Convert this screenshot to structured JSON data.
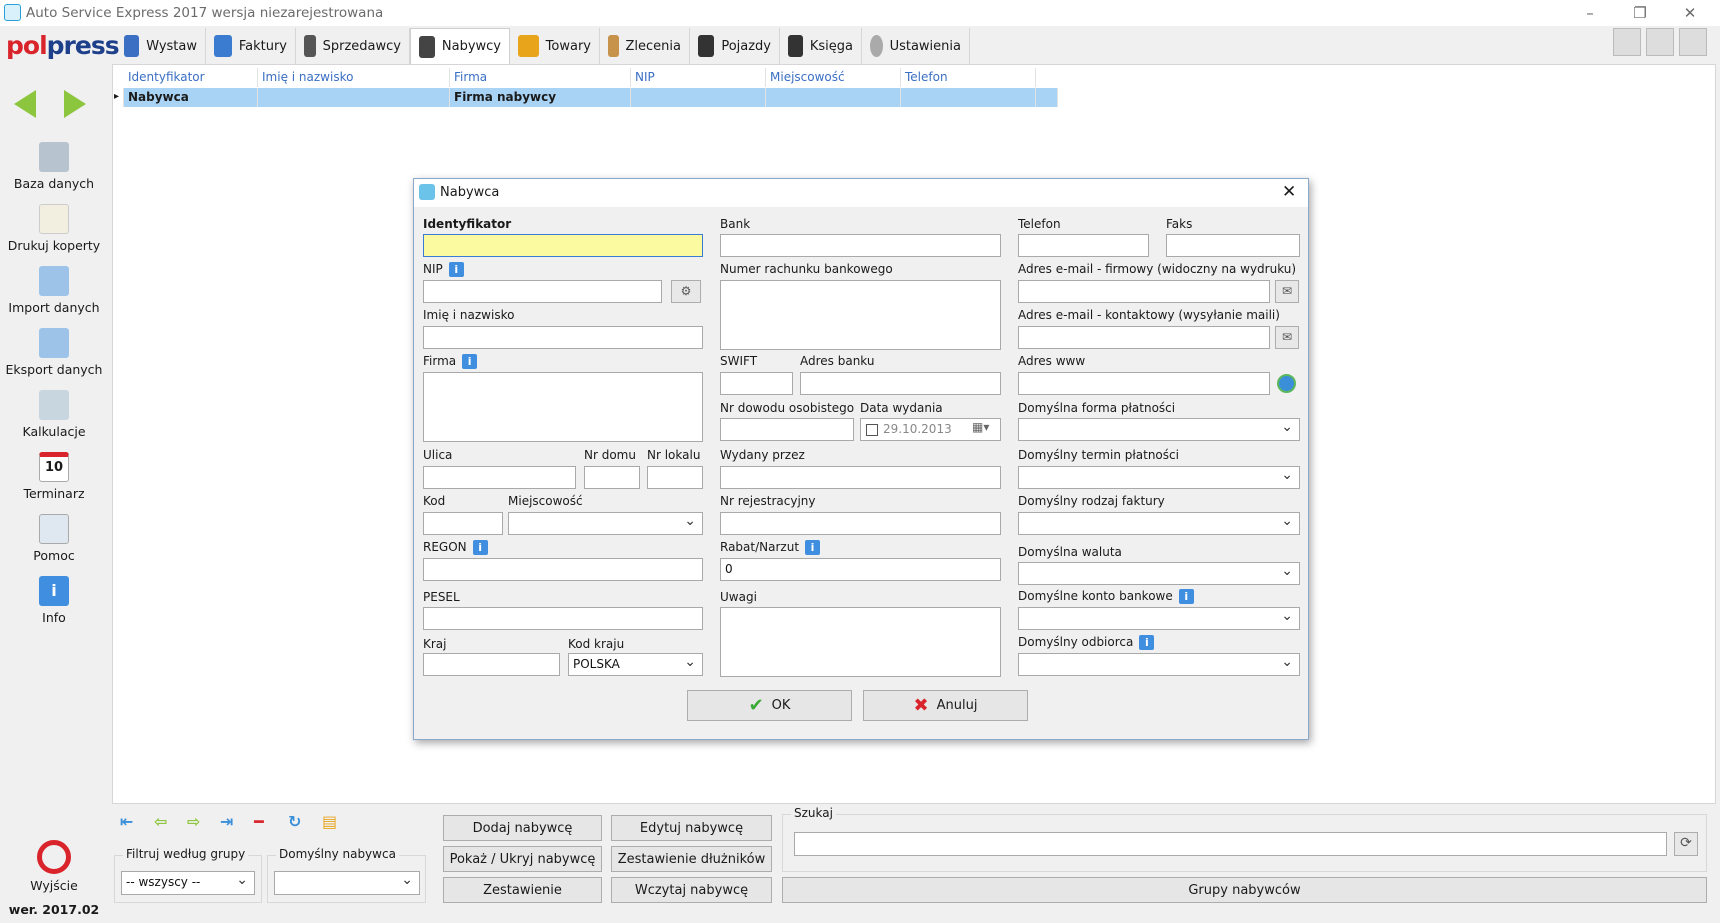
{
  "window": {
    "title": "Auto Service Express 2017 wersja niezarejestrowana"
  },
  "logo": {
    "part1": "pol",
    "part2": "press"
  },
  "tabs": [
    {
      "label": "Wystaw",
      "icon": "home-icon",
      "color": "#3b6fc4"
    },
    {
      "label": "Faktury",
      "icon": "invoice-icon",
      "color": "#3b7bd0"
    },
    {
      "label": "Sprzedawcy",
      "icon": "seller-icon",
      "color": "#555555"
    },
    {
      "label": "Nabywcy",
      "icon": "buyer-icon",
      "color": "#444444"
    },
    {
      "label": "Towary",
      "icon": "box-icon",
      "color": "#e8a51c"
    },
    {
      "label": "Zlecenia",
      "icon": "clipboard-icon",
      "color": "#c7924a"
    },
    {
      "label": "Pojazdy",
      "icon": "car-icon",
      "color": "#333333"
    },
    {
      "label": "Księga",
      "icon": "briefcase-icon",
      "color": "#333333"
    },
    {
      "label": "Ustawienia",
      "icon": "gear-icon",
      "color": "#888888"
    }
  ],
  "sidebar": {
    "items": [
      {
        "label": "Baza danych",
        "icon": "database-icon"
      },
      {
        "label": "Drukuj koperty",
        "icon": "envelope-icon"
      },
      {
        "label": "Import danych",
        "icon": "import-icon"
      },
      {
        "label": "Eksport danych",
        "icon": "export-icon"
      },
      {
        "label": "Kalkulacje",
        "icon": "calculator-icon"
      },
      {
        "label": "Terminarz",
        "icon": "calendar-icon",
        "day": "10"
      },
      {
        "label": "Pomoc",
        "icon": "help-icon"
      },
      {
        "label": "Info",
        "icon": "info-icon"
      }
    ],
    "exit_label": "Wyjście",
    "version": "wer. 2017.02"
  },
  "grid": {
    "columns": [
      "Identyfikator",
      "Imię i nazwisko",
      "Firma",
      "NIP",
      "Miejscowość",
      "Telefon"
    ],
    "rows": [
      [
        "Nabywca",
        "",
        "Firma nabywcy",
        "",
        "",
        ""
      ]
    ]
  },
  "dialog": {
    "title": "Nabywca",
    "fields": {
      "identyfikator": "Identyfikator",
      "nip": "NIP",
      "imie": "Imię i nazwisko",
      "firma": "Firma",
      "ulica": "Ulica",
      "nr_domu": "Nr domu",
      "nr_lokalu": "Nr lokalu",
      "kod": "Kod",
      "miejscowosc": "Miejscowość",
      "regon": "REGON",
      "pesel": "PESEL",
      "kraj": "Kraj",
      "kod_kraju": "Kod kraju",
      "kod_kraju_value": "POLSKA",
      "bank": "Bank",
      "numer_rachunku": "Numer rachunku bankowego",
      "swift": "SWIFT",
      "adres_banku": "Adres banku",
      "nr_dowodu": "Nr dowodu osobistego",
      "data_wydania": "Data wydania",
      "data_wydania_value": "29.10.2013",
      "wydany_przez": "Wydany przez",
      "nr_rejestracyjny": "Nr rejestracyjny",
      "rabat": "Rabat/Narzut",
      "rabat_value": "0",
      "uwagi": "Uwagi",
      "telefon": "Telefon",
      "faks": "Faks",
      "email_firmowy": "Adres e-mail - firmowy (widoczny na wydruku)",
      "email_kontaktowy": "Adres e-mail - kontaktowy (wysyłanie maili)",
      "www": "Adres www",
      "forma_platnosci": "Domyślna forma płatności",
      "termin_platnosci": "Domyślny termin płatności",
      "rodzaj_faktury": "Domyślny rodzaj faktury",
      "waluta": "Domyślna waluta",
      "konto_bankowe": "Domyślne konto bankowe",
      "odbiorca": "Domyślny odbiorca"
    },
    "ok_label": "OK",
    "cancel_label": "Anuluj"
  },
  "bottom": {
    "filter_group_label": "Filtruj według grupy",
    "filter_group_value": "-- wszyscy --",
    "default_buyer_label": "Domyślny nabywca",
    "buttons": {
      "add": "Dodaj nabywcę",
      "edit": "Edytuj nabywcę",
      "show_hide": "Pokaż / Ukryj nabywcę",
      "debtors": "Zestawienie dłużników",
      "summary": "Zestawienie",
      "load": "Wczytaj nabywcę",
      "groups": "Grupy nabywców"
    },
    "search_label": "Szukaj"
  },
  "colors": {
    "highlight_row": "#a9d3f5",
    "focused_input": "#fbfaa0",
    "accent_red": "#d9242b"
  }
}
